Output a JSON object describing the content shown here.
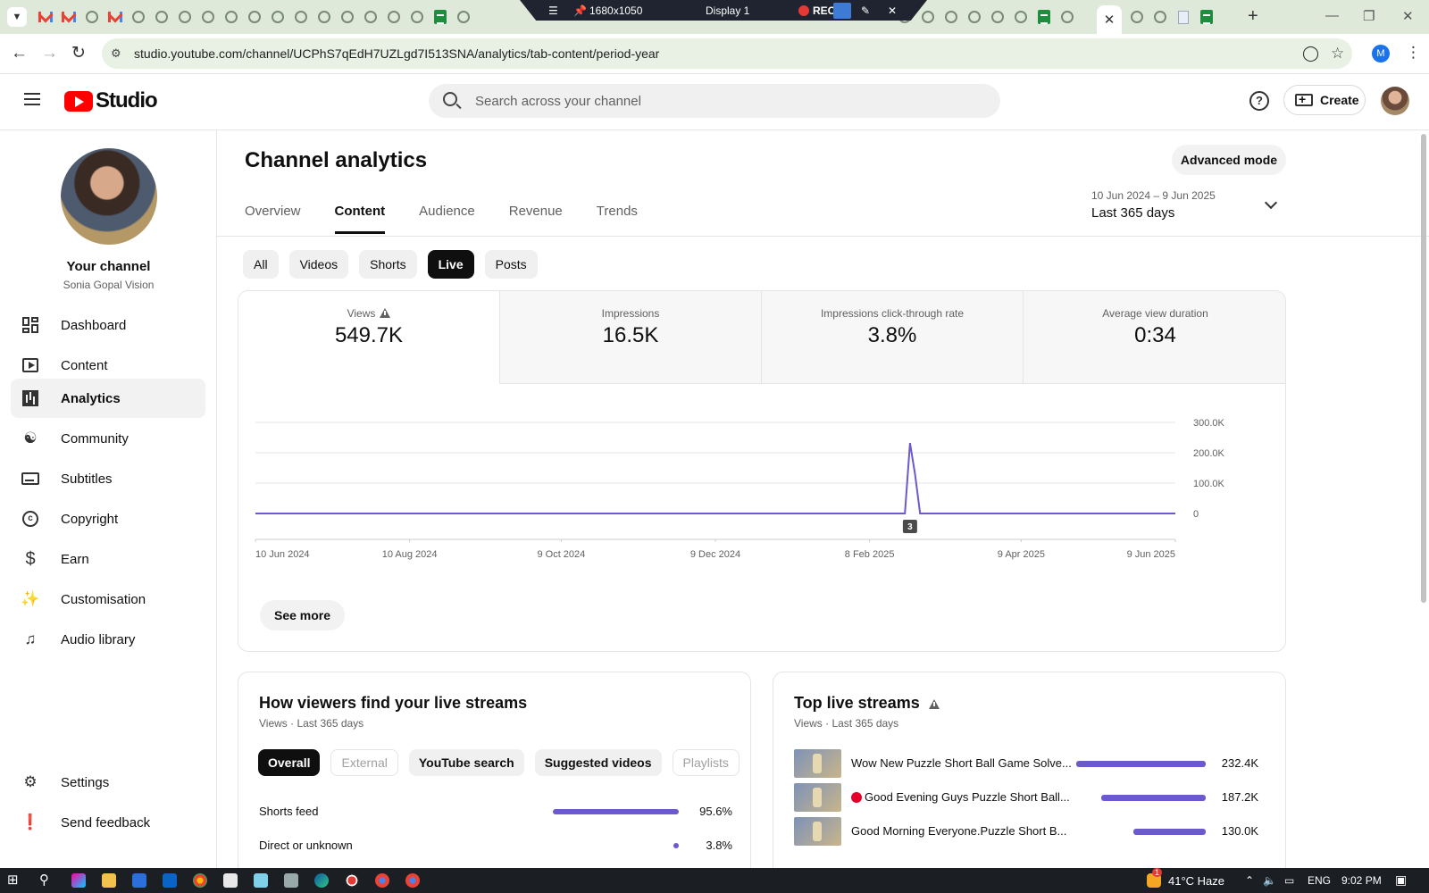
{
  "browser": {
    "display_bar": {
      "resolution": "1680x1050",
      "display": "Display 1",
      "rec": "REC"
    },
    "url": "studio.youtube.com/channel/UCPhS7qEdH7UZLgd7I513SNA/analytics/tab-content/period-year",
    "profile_initial": "M"
  },
  "header": {
    "logo_text": "Studio",
    "search_placeholder": "Search across your channel",
    "create_label": "Create"
  },
  "sidebar": {
    "channel_label": "Your channel",
    "channel_name": "Sonia Gopal Vision",
    "items": [
      {
        "label": "Dashboard",
        "icon": "dashboard-icon"
      },
      {
        "label": "Content",
        "icon": "content-icon"
      },
      {
        "label": "Analytics",
        "icon": "analytics-icon",
        "active": true
      },
      {
        "label": "Community",
        "icon": "community-icon"
      },
      {
        "label": "Subtitles",
        "icon": "subtitles-icon"
      },
      {
        "label": "Copyright",
        "icon": "copyright-icon"
      },
      {
        "label": "Earn",
        "icon": "earn-icon"
      },
      {
        "label": "Customisation",
        "icon": "customisation-icon"
      },
      {
        "label": "Audio library",
        "icon": "audio-library-icon"
      }
    ],
    "bottom_items": [
      {
        "label": "Settings",
        "icon": "settings-icon"
      },
      {
        "label": "Send feedback",
        "icon": "feedback-icon"
      }
    ]
  },
  "page": {
    "title": "Channel analytics",
    "advanced_mode": "Advanced mode",
    "tabs": [
      "Overview",
      "Content",
      "Audience",
      "Revenue",
      "Trends"
    ],
    "active_tab": "Content",
    "date_range": "10 Jun 2024 – 9 Jun 2025",
    "date_label": "Last 365 days",
    "filters": [
      "All",
      "Videos",
      "Shorts",
      "Live",
      "Posts"
    ],
    "active_filter": "Live"
  },
  "metrics": [
    {
      "label": "Views",
      "value": "549.7K",
      "warning": true
    },
    {
      "label": "Impressions",
      "value": "16.5K"
    },
    {
      "label": "Impressions click-through rate",
      "value": "3.8%"
    },
    {
      "label": "Average view duration",
      "value": "0:34"
    }
  ],
  "chart_data": {
    "type": "line",
    "series": [
      {
        "points": [
          {
            "x": "2024-06-10",
            "y": 0
          },
          {
            "x": "2025-02-22",
            "y": 0
          },
          {
            "x": "2025-02-24",
            "y": 232000
          },
          {
            "x": "2025-02-26",
            "y": 130000
          },
          {
            "x": "2025-02-28",
            "y": 0
          },
          {
            "x": "2025-06-09",
            "y": 0
          }
        ]
      }
    ],
    "x_ticks": [
      "10 Jun 2024",
      "10 Aug 2024",
      "9 Oct 2024",
      "9 Dec 2024",
      "8 Feb 2025",
      "9 Apr 2025",
      "9 Jun 2025"
    ],
    "y_ticks": [
      "300.0K",
      "200.0K",
      "100.0K",
      "0"
    ],
    "ylim": [
      0,
      300000
    ],
    "marker": {
      "x": "2025-02-24",
      "label": "3"
    },
    "line_color": "#6a5acd"
  },
  "see_more": "See more",
  "traffic_card": {
    "title": "How viewers find your live streams",
    "subtitle": "Views · Last 365 days",
    "chips": [
      {
        "label": "Overall",
        "state": "active"
      },
      {
        "label": "External",
        "state": "disabled"
      },
      {
        "label": "YouTube search",
        "state": "normal"
      },
      {
        "label": "Suggested videos",
        "state": "normal"
      },
      {
        "label": "Playlists",
        "state": "disabled"
      }
    ],
    "rows": [
      {
        "name": "Shorts feed",
        "value": "95.6%",
        "fraction": 0.956
      },
      {
        "name": "Direct or unknown",
        "value": "3.8%",
        "fraction": 0.038
      }
    ]
  },
  "top_card": {
    "title": "Top live streams",
    "subtitle": "Views · Last 365 days",
    "rows": [
      {
        "title": "Wow New Puzzle Short Ball Game Solve...",
        "value": "232.4K",
        "fraction": 1.0,
        "live": false
      },
      {
        "title": "Good Evening Guys Puzzle Short Ball...",
        "value": "187.2K",
        "fraction": 0.805,
        "live": true
      },
      {
        "title": "Good Morning Everyone.Puzzle Short B...",
        "value": "130.0K",
        "fraction": 0.559,
        "live": false
      }
    ]
  },
  "taskbar": {
    "weather": "41°C Haze",
    "language": "ENG",
    "time": "9:02 PM",
    "notification_count": "1"
  }
}
